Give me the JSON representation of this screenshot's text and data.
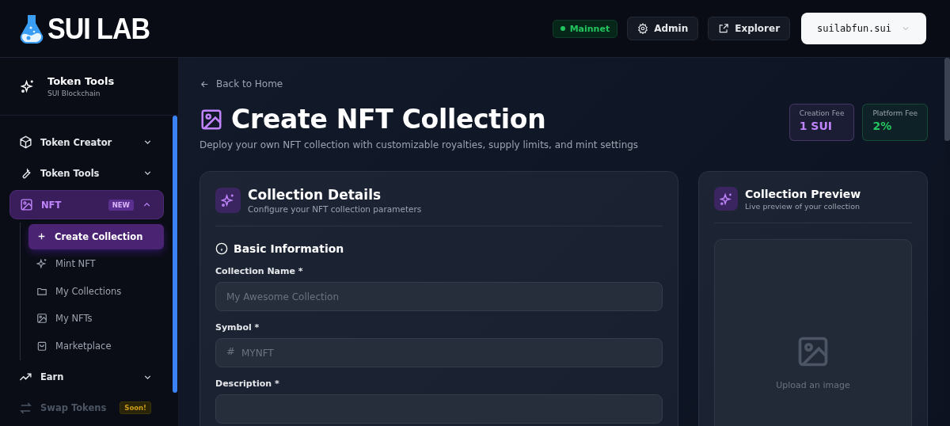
{
  "header": {
    "logo": "SUI LAB",
    "network": {
      "label": "Mainnet",
      "color": "#22c55e"
    },
    "buttons": [
      {
        "label": "Admin",
        "kind": "settings"
      },
      {
        "label": "Explorer",
        "kind": "external"
      }
    ],
    "wallet": {
      "label": "suilabfun.sui"
    }
  },
  "sidebar": {
    "title": "Token Tools",
    "subtitle": "SUI Blockchain",
    "items": [
      {
        "label": "Token Creator",
        "expanded": false,
        "selected": false,
        "disabled": false
      },
      {
        "label": "Token Tools",
        "expanded": false,
        "selected": false,
        "disabled": false
      },
      {
        "label": "NFT",
        "expanded": true,
        "selected": true,
        "disabled": false,
        "badge": "NEW",
        "children": [
          {
            "label": "Create Collection",
            "selected": true
          },
          {
            "label": "Mint NFT",
            "selected": false
          },
          {
            "label": "My Collections",
            "selected": false
          },
          {
            "label": "My NFTs",
            "selected": false
          },
          {
            "label": "Marketplace",
            "selected": false
          }
        ]
      },
      {
        "label": "Earn",
        "expanded": false,
        "selected": false,
        "disabled": false
      },
      {
        "label": "Swap Tokens",
        "selected": false,
        "disabled": true,
        "badge": "Soon!"
      }
    ]
  },
  "main": {
    "back_link": "Back to Home",
    "title": "Create NFT Collection",
    "subtitle": "Deploy your own NFT collection with customizable royalties, supply limits, and mint settings",
    "fees": [
      {
        "label": "Creation Fee",
        "value": "1 SUI",
        "color": "#c084fc"
      },
      {
        "label": "Platform Fee",
        "value": "2%",
        "color": "#22c55e"
      }
    ],
    "details_card": {
      "title": "Collection Details",
      "subtitle": "Configure your NFT collection parameters",
      "section": "Basic Information",
      "fields": [
        {
          "label": "Collection Name *",
          "placeholder": "My Awesome Collection"
        },
        {
          "label": "Symbol *",
          "placeholder": "MYNFT",
          "prefix": "#"
        },
        {
          "label": "Description *"
        }
      ]
    },
    "preview_card": {
      "title": "Collection Preview",
      "subtitle": "Live preview of your collection",
      "upload_text": "Upload an image"
    }
  }
}
